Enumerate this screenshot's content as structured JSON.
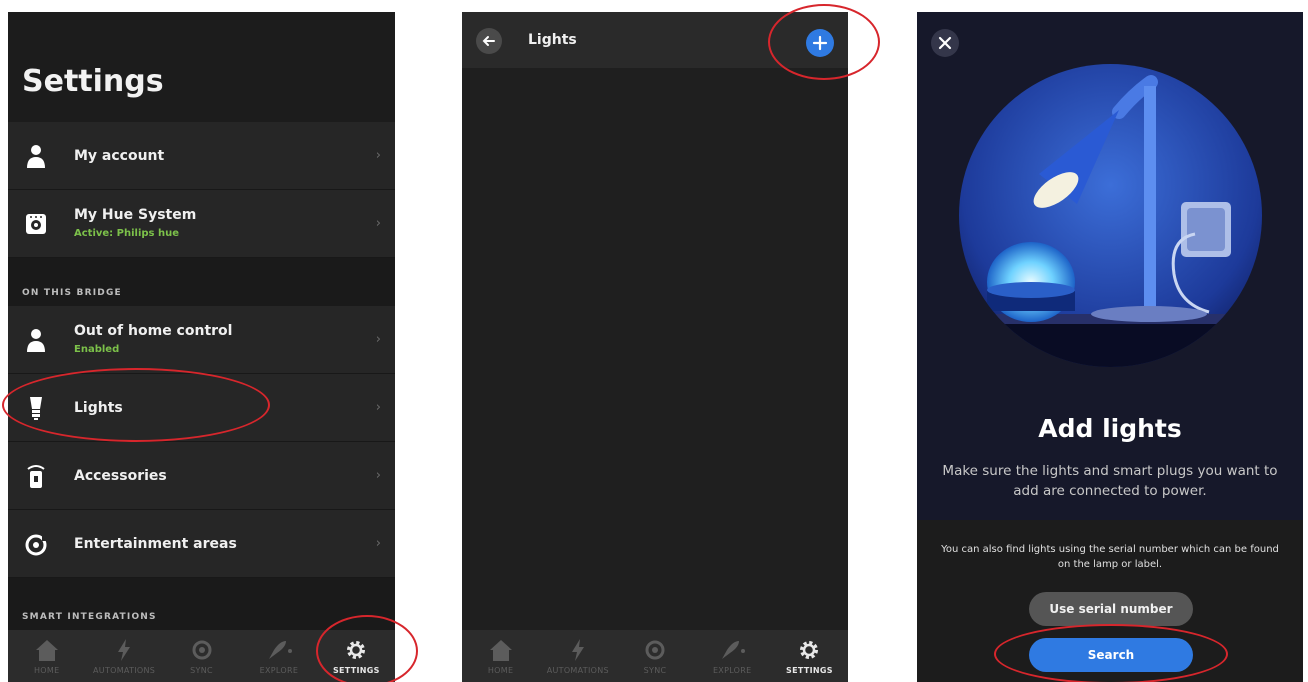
{
  "colors": {
    "accent": "#2f7ae2",
    "status_green": "#7cc14a",
    "annotation_red": "#d7262c",
    "row_bg": "#262626",
    "nav_bg": "#2c2c2c"
  },
  "nav": {
    "items": [
      {
        "label": "HOME",
        "icon": "home-icon",
        "active": false
      },
      {
        "label": "AUTOMATIONS",
        "icon": "lightning-icon",
        "active": false
      },
      {
        "label": "SYNC",
        "icon": "sync-icon",
        "active": false
      },
      {
        "label": "EXPLORE",
        "icon": "rocket-icon",
        "active": false
      },
      {
        "label": "SETTINGS",
        "icon": "gear-icon",
        "active": true
      }
    ]
  },
  "settings": {
    "title": "Settings",
    "rows": [
      {
        "title": "My account",
        "icon": "person-icon"
      },
      {
        "title": "My Hue System",
        "subtitle": "Active: Philips hue",
        "icon": "bridge-icon"
      },
      {
        "title": "Out of home control",
        "subtitle": "Enabled",
        "icon": "person-icon"
      },
      {
        "title": "Lights",
        "icon": "bulb-icon"
      },
      {
        "title": "Accessories",
        "icon": "remote-icon"
      },
      {
        "title": "Entertainment areas",
        "icon": "entertainment-icon"
      }
    ],
    "section_bridge": "ON THIS BRIDGE",
    "section_smart": "SMART INTEGRATIONS",
    "chevron": "›"
  },
  "lights_screen": {
    "title": "Lights"
  },
  "add_lights": {
    "title": "Add lights",
    "description": "Make sure the lights and smart plugs you want to add are connected to power.",
    "serial_note": "You can also find lights using the serial number which can be found on the lamp or label.",
    "serial_button": "Use serial number",
    "search_button": "Search"
  }
}
